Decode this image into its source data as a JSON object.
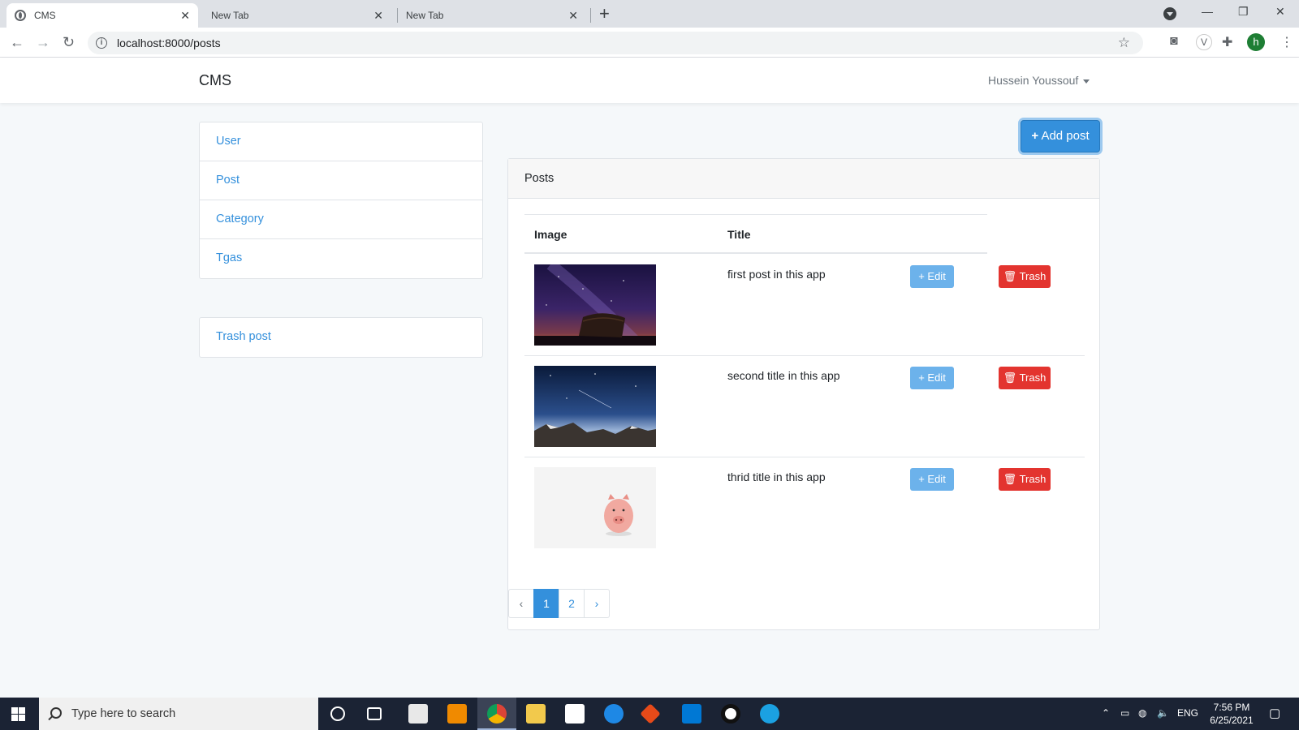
{
  "browser": {
    "tabs": [
      {
        "title": "CMS",
        "close": "✕"
      },
      {
        "title": "New Tab",
        "close": "✕"
      },
      {
        "title": "New Tab",
        "close": "✕"
      }
    ],
    "new_tab": "+",
    "url": "localhost:8000/posts",
    "profile_initial": "h",
    "window_controls": {
      "minimize": "—",
      "restore": "❐",
      "close": "✕"
    }
  },
  "navbar": {
    "brand": "CMS",
    "user": "Hussein Youssouf"
  },
  "sidebar": {
    "items": [
      {
        "label": "User"
      },
      {
        "label": "Post"
      },
      {
        "label": "Category"
      },
      {
        "label": "Tgas"
      }
    ],
    "secondary": [
      {
        "label": "Trash post"
      }
    ]
  },
  "main": {
    "add_button": "Add post",
    "add_icon": "+",
    "card_title": "Posts",
    "columns": [
      "Image",
      "Title"
    ],
    "posts": [
      {
        "title": "first post in this app",
        "image": "boat-night-sky",
        "edit": "Edit",
        "trash": "Trash"
      },
      {
        "title": "second title in this app",
        "image": "mountain-starry-sky",
        "edit": "Edit",
        "trash": "Trash"
      },
      {
        "title": "thrid title in this app",
        "image": "piggy-bank",
        "edit": "Edit",
        "trash": "Trash"
      }
    ],
    "pagination": {
      "prev": "‹",
      "pages": [
        "1",
        "2"
      ],
      "current": "1",
      "next": "›"
    }
  },
  "colors": {
    "primary": "#3490dc",
    "info": "#6cb2eb",
    "danger": "#e3342f",
    "taskbar": "#1b2334"
  },
  "taskbar": {
    "search_placeholder": "Type here to search",
    "language": "ENG",
    "time": "7:56 PM",
    "date": "6/25/2021"
  }
}
